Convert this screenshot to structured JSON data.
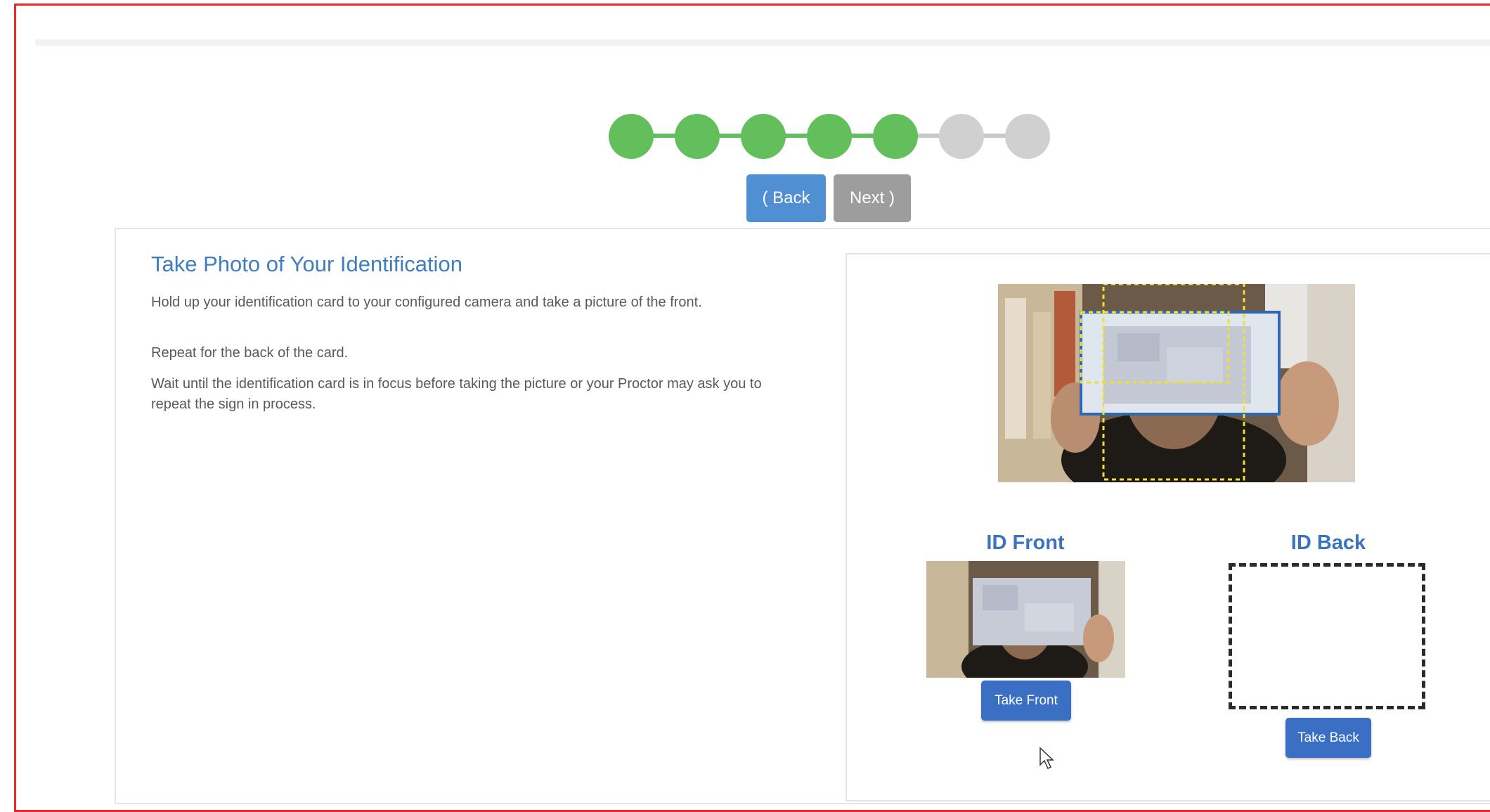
{
  "nav": {
    "back_label": "( Back",
    "next_label": "Next )"
  },
  "progress": {
    "total_steps": 7,
    "completed_steps": 5,
    "done_color": "#62bf5c",
    "pending_color": "#d0d0d0"
  },
  "instructions": {
    "title": "Take Photo of Your Identification",
    "paragraphs": [
      "Hold up your identification card to your configured camera and take a picture of the front.",
      "Repeat for the back of the card.",
      "Wait until the identification card is in focus before taking the picture or your Proctor may ask you to repeat the sign in process."
    ]
  },
  "capture": {
    "front_label": "ID Front",
    "back_label": "ID Back",
    "take_front_label": "Take Front",
    "take_back_label": "Take Back"
  },
  "colors": {
    "accent": "#3f7cc0",
    "button_primary": "#3a6fc4",
    "frame_border": "#e62a2a"
  }
}
